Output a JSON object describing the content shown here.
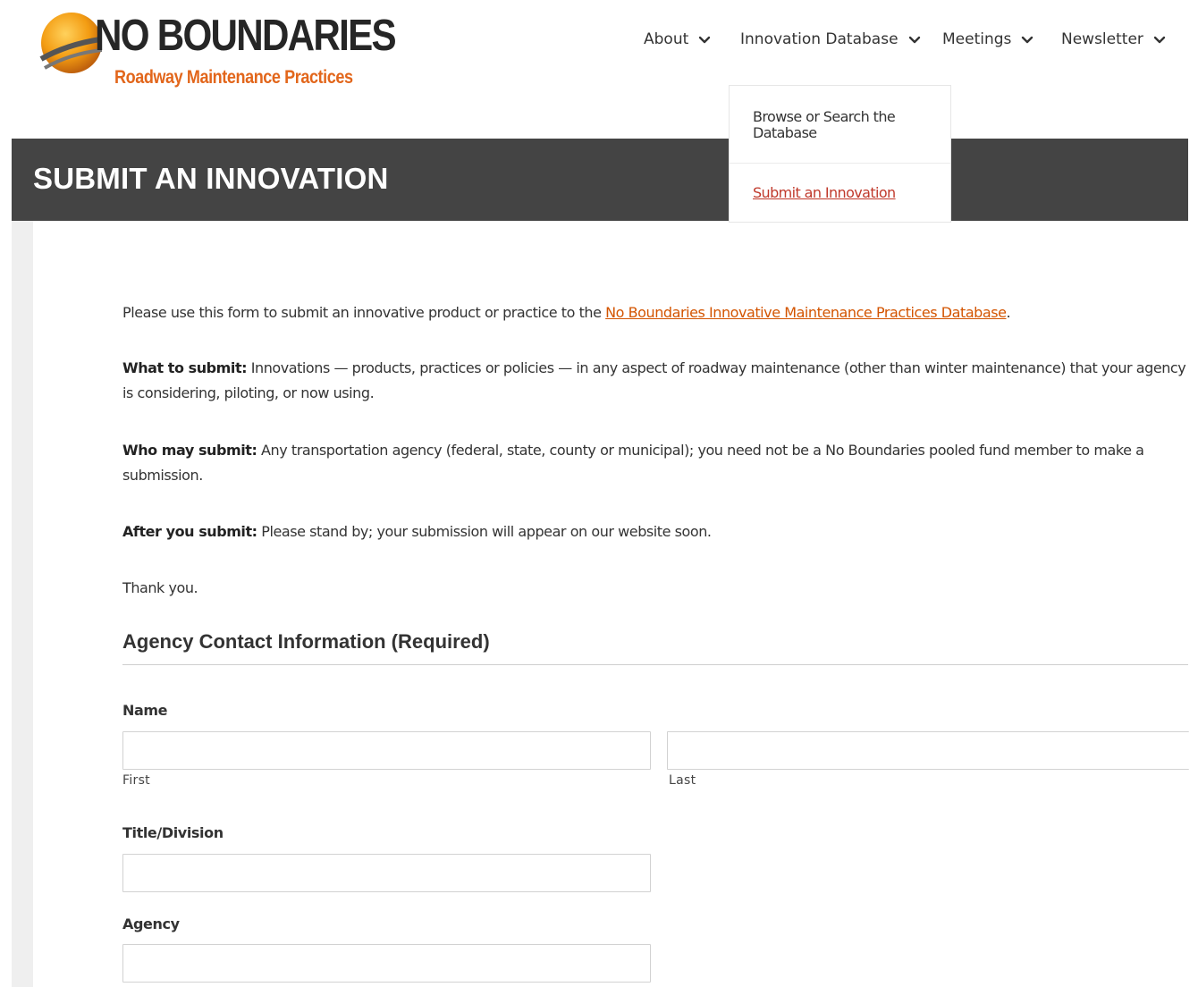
{
  "logo": {
    "title": "NO BOUNDARIES",
    "subtitle": "Roadway Maintenance Practices",
    "colors": {
      "orange": "#e2661b",
      "dark": "#262626"
    }
  },
  "nav": {
    "items": [
      {
        "label": "About",
        "icon": "chevron-down-icon"
      },
      {
        "label": "Innovation Database",
        "icon": "chevron-down-icon"
      },
      {
        "label": "Meetings",
        "icon": "chevron-down-icon"
      },
      {
        "label": "Newsletter",
        "icon": "chevron-down-icon"
      }
    ],
    "dropdown": {
      "items": [
        {
          "label": "Browse or Search the Database"
        },
        {
          "label": "Submit an Innovation",
          "active": true
        }
      ]
    }
  },
  "page": {
    "title": "SUBMIT AN INNOVATION"
  },
  "intro": {
    "p1_text": "Please use this form to submit an innovative product or practice to the ",
    "p1_link": "No Boundaries Innovative Maintenance Practices Database",
    "p1_end": ".",
    "p2_label": "What to submit:",
    "p2_text": " Innovations — products, practices or policies — in any aspect of roadway maintenance (other than winter maintenance) that your agency is considering, piloting, or now using.",
    "p3_label": "Who may submit:",
    "p3_text": " Any transportation agency (federal, state, county or municipal); you need not be a No Boundaries pooled fund member to make a submission.",
    "p4_label": "After you submit:",
    "p4_text": " Please stand by; your submission will appear on our website soon.",
    "p5_text": "Thank you."
  },
  "form": {
    "section_title": "Agency Contact Information (Required)",
    "name_label": "Name",
    "first_sublabel": "First",
    "last_sublabel": "Last",
    "first_value": "",
    "last_value": "",
    "title_label": "Title/Division",
    "title_value": "",
    "agency_label": "Agency",
    "agency_value": ""
  },
  "colors": {
    "banner": "#444444",
    "link": "#d35400",
    "active_menu": "#c0392b"
  }
}
